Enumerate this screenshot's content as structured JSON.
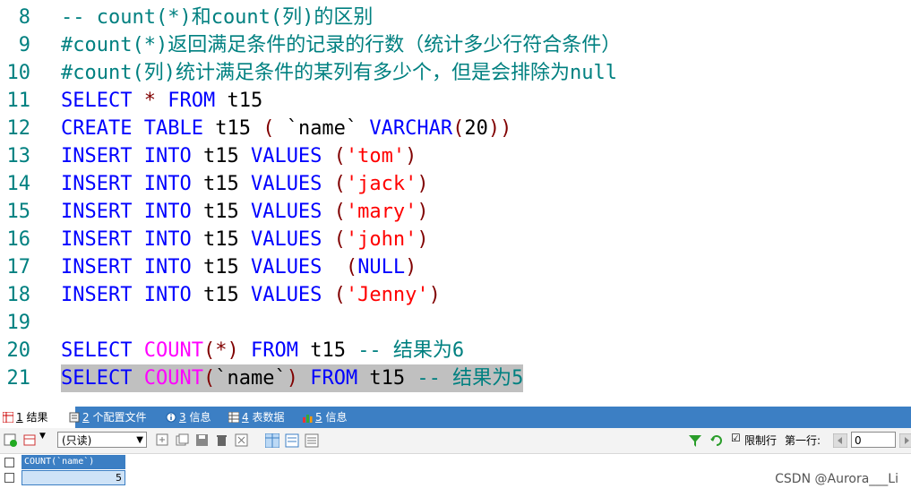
{
  "editor": {
    "lines": [
      {
        "n": "8",
        "segs": [
          {
            "t": "-- count(*)和count(列)的区别",
            "c": "cmt"
          }
        ]
      },
      {
        "n": "9",
        "segs": [
          {
            "t": "#count(*)返回满足条件的记录的行数（统计多少行符合条件）",
            "c": "cmt"
          }
        ]
      },
      {
        "n": "10",
        "segs": [
          {
            "t": "#count(列)统计满足条件的某列有多少个，但是会排除为null",
            "c": "cmt"
          }
        ]
      },
      {
        "n": "11",
        "segs": [
          {
            "t": "SELECT",
            "c": "kw"
          },
          {
            "t": " * ",
            "c": "paren"
          },
          {
            "t": "FROM",
            "c": "kw"
          },
          {
            "t": " t15",
            "c": "plain"
          }
        ]
      },
      {
        "n": "12",
        "segs": [
          {
            "t": "CREATE",
            "c": "kw"
          },
          {
            "t": " ",
            "c": "plain"
          },
          {
            "t": "TABLE",
            "c": "kw"
          },
          {
            "t": " t15 ",
            "c": "plain"
          },
          {
            "t": "(",
            "c": "paren"
          },
          {
            "t": " `name` ",
            "c": "plain"
          },
          {
            "t": "VARCHAR",
            "c": "kw"
          },
          {
            "t": "(",
            "c": "paren"
          },
          {
            "t": "20",
            "c": "plain"
          },
          {
            "t": "))",
            "c": "paren"
          }
        ]
      },
      {
        "n": "13",
        "segs": [
          {
            "t": "INSERT",
            "c": "kw"
          },
          {
            "t": " ",
            "c": "plain"
          },
          {
            "t": "INTO",
            "c": "kw"
          },
          {
            "t": " t15 ",
            "c": "plain"
          },
          {
            "t": "VALUES",
            "c": "kw"
          },
          {
            "t": " (",
            "c": "paren"
          },
          {
            "t": "'tom'",
            "c": "str"
          },
          {
            "t": ")",
            "c": "paren"
          }
        ]
      },
      {
        "n": "14",
        "segs": [
          {
            "t": "INSERT",
            "c": "kw"
          },
          {
            "t": " ",
            "c": "plain"
          },
          {
            "t": "INTO",
            "c": "kw"
          },
          {
            "t": " t15 ",
            "c": "plain"
          },
          {
            "t": "VALUES",
            "c": "kw"
          },
          {
            "t": " (",
            "c": "paren"
          },
          {
            "t": "'jack'",
            "c": "str"
          },
          {
            "t": ")",
            "c": "paren"
          }
        ]
      },
      {
        "n": "15",
        "segs": [
          {
            "t": "INSERT",
            "c": "kw"
          },
          {
            "t": " ",
            "c": "plain"
          },
          {
            "t": "INTO",
            "c": "kw"
          },
          {
            "t": " t15 ",
            "c": "plain"
          },
          {
            "t": "VALUES",
            "c": "kw"
          },
          {
            "t": " (",
            "c": "paren"
          },
          {
            "t": "'mary'",
            "c": "str"
          },
          {
            "t": ")",
            "c": "paren"
          }
        ]
      },
      {
        "n": "16",
        "segs": [
          {
            "t": "INSERT",
            "c": "kw"
          },
          {
            "t": " ",
            "c": "plain"
          },
          {
            "t": "INTO",
            "c": "kw"
          },
          {
            "t": " t15 ",
            "c": "plain"
          },
          {
            "t": "VALUES",
            "c": "kw"
          },
          {
            "t": " (",
            "c": "paren"
          },
          {
            "t": "'john'",
            "c": "str"
          },
          {
            "t": ")",
            "c": "paren"
          }
        ]
      },
      {
        "n": "17",
        "segs": [
          {
            "t": "INSERT",
            "c": "kw"
          },
          {
            "t": " ",
            "c": "plain"
          },
          {
            "t": "INTO",
            "c": "kw"
          },
          {
            "t": " t15 ",
            "c": "plain"
          },
          {
            "t": "VALUES",
            "c": "kw"
          },
          {
            "t": "  (",
            "c": "paren"
          },
          {
            "t": "NULL",
            "c": "kw"
          },
          {
            "t": ")",
            "c": "paren"
          }
        ]
      },
      {
        "n": "18",
        "segs": [
          {
            "t": "INSERT",
            "c": "kw"
          },
          {
            "t": " ",
            "c": "plain"
          },
          {
            "t": "INTO",
            "c": "kw"
          },
          {
            "t": " t15 ",
            "c": "plain"
          },
          {
            "t": "VALUES",
            "c": "kw"
          },
          {
            "t": " (",
            "c": "paren"
          },
          {
            "t": "'Jenny'",
            "c": "str"
          },
          {
            "t": ")",
            "c": "paren"
          }
        ]
      },
      {
        "n": "19",
        "segs": []
      },
      {
        "n": "20",
        "segs": [
          {
            "t": "SELECT",
            "c": "kw"
          },
          {
            "t": " ",
            "c": "plain"
          },
          {
            "t": "COUNT",
            "c": "fn"
          },
          {
            "t": "(*)",
            "c": "paren"
          },
          {
            "t": " ",
            "c": "plain"
          },
          {
            "t": "FROM",
            "c": "kw"
          },
          {
            "t": " t15 ",
            "c": "plain"
          },
          {
            "t": "-- 结果为6",
            "c": "cmt"
          }
        ]
      },
      {
        "n": "21",
        "hl": true,
        "segs": [
          {
            "t": "SELECT",
            "c": "kw"
          },
          {
            "t": " ",
            "c": "plain"
          },
          {
            "t": "COUNT",
            "c": "fn"
          },
          {
            "t": "(",
            "c": "paren"
          },
          {
            "t": "`name`",
            "c": "plain"
          },
          {
            "t": ")",
            "c": "paren"
          },
          {
            "t": " ",
            "c": "plain"
          },
          {
            "t": "FROM",
            "c": "kw"
          },
          {
            "t": " t15 ",
            "c": "plain"
          },
          {
            "t": "-- 结果为5",
            "c": "cmt"
          }
        ]
      }
    ]
  },
  "tabs": [
    {
      "num": "1",
      "label": "结果",
      "icon": "result-grid-icon"
    },
    {
      "num": "2",
      "label": "个配置文件",
      "icon": "profile-icon"
    },
    {
      "num": "3",
      "label": "信息",
      "icon": "info-icon"
    },
    {
      "num": "4",
      "label": "表数据",
      "icon": "table-data-icon"
    },
    {
      "num": "5",
      "label": "信息",
      "icon": "info-chart-icon"
    }
  ],
  "toolbar": {
    "mode_select": "(只读)",
    "limit_label": "限制行",
    "first_row_label": "第一行:",
    "first_row_value": "0",
    "limit_checked": true
  },
  "grid": {
    "header": "COUNT(`name`)",
    "rows": [
      [
        "5"
      ]
    ]
  },
  "watermark": "CSDN @Aurora___Li",
  "colors": {
    "tab_bar": "#3c7fc4",
    "keyword": "#0000ff",
    "function": "#ff00ff",
    "string": "#ff0000",
    "comment": "#008080"
  }
}
